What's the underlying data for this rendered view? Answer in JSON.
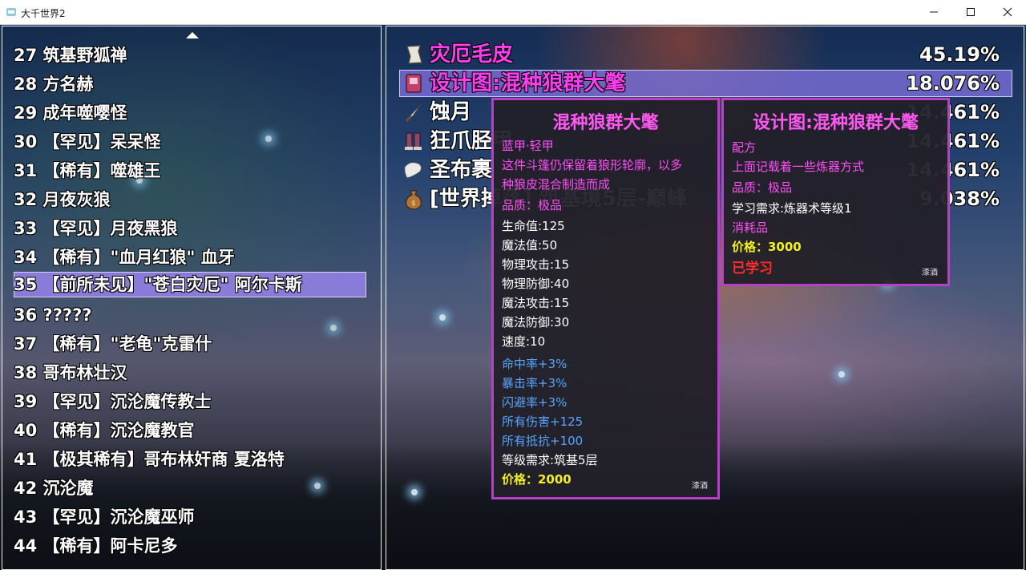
{
  "window": {
    "title": "大千世界2",
    "buttons": [
      "minimize",
      "maximize",
      "close"
    ]
  },
  "left_list": {
    "items": [
      "27 筑基野狐禅",
      "28 方名赫",
      "29 成年噬嘤怪",
      "30 【罕见】呆呆怪",
      "31 【稀有】噬雄王",
      "32 月夜灰狼",
      "33 【罕见】月夜黑狼",
      "34 【稀有】\"血月红狼\" 血牙",
      "35 【前所未见】\"苍白灾厄\" 阿尔卡斯",
      "36 ?????",
      "37 【稀有】\"老龟\"克雷什",
      "38 哥布林壮汉",
      "39 【罕见】沉沦魔传教士",
      "40 【稀有】沉沦魔教官",
      "41 【极其稀有】哥布林奸商 夏洛特",
      "42 沉沦魔",
      "43 【罕见】沉沦魔巫师",
      "44 【稀有】阿卡尼多"
    ],
    "selected_index": 8
  },
  "loot": {
    "rows": [
      {
        "name": "灾厄毛皮",
        "pct": "45.19%",
        "icon": "scroll-icon",
        "pink": true
      },
      {
        "name": "设计图:混种狼群大氅",
        "pct": "18.076%",
        "icon": "book-icon",
        "pink": true
      },
      {
        "name": "蚀月",
        "pct": "14.461%",
        "icon": "sword-icon",
        "pink": false
      },
      {
        "name": "狂爪胫甲",
        "pct": "14.461%",
        "icon": "greaves-icon",
        "pink": false
      },
      {
        "name": "圣布裹",
        "pct": "14.461%",
        "icon": "cloth-icon",
        "pink": false
      },
      {
        "name": "[世界掉落] 筑基境5层-巅峰",
        "pct": "9.038%",
        "icon": "bag-icon",
        "pink": false
      }
    ],
    "selected_index": 1
  },
  "tooltip_item": {
    "title": "混种狼群大氅",
    "lines": [
      {
        "text": "蓝甲·轻甲",
        "color": "pink"
      },
      {
        "text": "这件斗篷仍保留着狼形轮廓，以多",
        "color": "pink"
      },
      {
        "text": "种狼皮混合制造而成",
        "color": "pink"
      },
      {
        "text": "品质：极品",
        "color": "pink"
      },
      {
        "text": "生命值:125",
        "color": "white"
      },
      {
        "text": "魔法值:50",
        "color": "white"
      },
      {
        "text": "物理攻击:15",
        "color": "white"
      },
      {
        "text": "物理防御:40",
        "color": "white"
      },
      {
        "text": "魔法攻击:15",
        "color": "white"
      },
      {
        "text": "魔法防御:30",
        "color": "white"
      },
      {
        "text": "速度:10",
        "color": "white"
      },
      {
        "text": "命中率+3%",
        "color": "blue"
      },
      {
        "text": "暴击率+3%",
        "color": "blue"
      },
      {
        "text": "闪避率+3%",
        "color": "blue"
      },
      {
        "text": "所有伤害+125",
        "color": "blue"
      },
      {
        "text": "所有抵抗+100",
        "color": "blue"
      },
      {
        "text": "等级需求:筑基5层",
        "color": "white"
      },
      {
        "text": "价格：2000",
        "color": "yellow"
      }
    ],
    "tag": "漆酒"
  },
  "tooltip_blueprint": {
    "title": "设计图:混种狼群大氅",
    "lines": [
      {
        "text": "配方",
        "color": "pink"
      },
      {
        "text": "上面记载着一些炼器方式",
        "color": "pink"
      },
      {
        "text": "品质：极品",
        "color": "pink"
      },
      {
        "text": "学习需求:炼器术等级1",
        "color": "white"
      },
      {
        "text": "消耗品",
        "color": "pink"
      },
      {
        "text": "价格：3000",
        "color": "yellow"
      },
      {
        "text": "已学习",
        "color": "red"
      }
    ],
    "tag": "漆酒"
  }
}
